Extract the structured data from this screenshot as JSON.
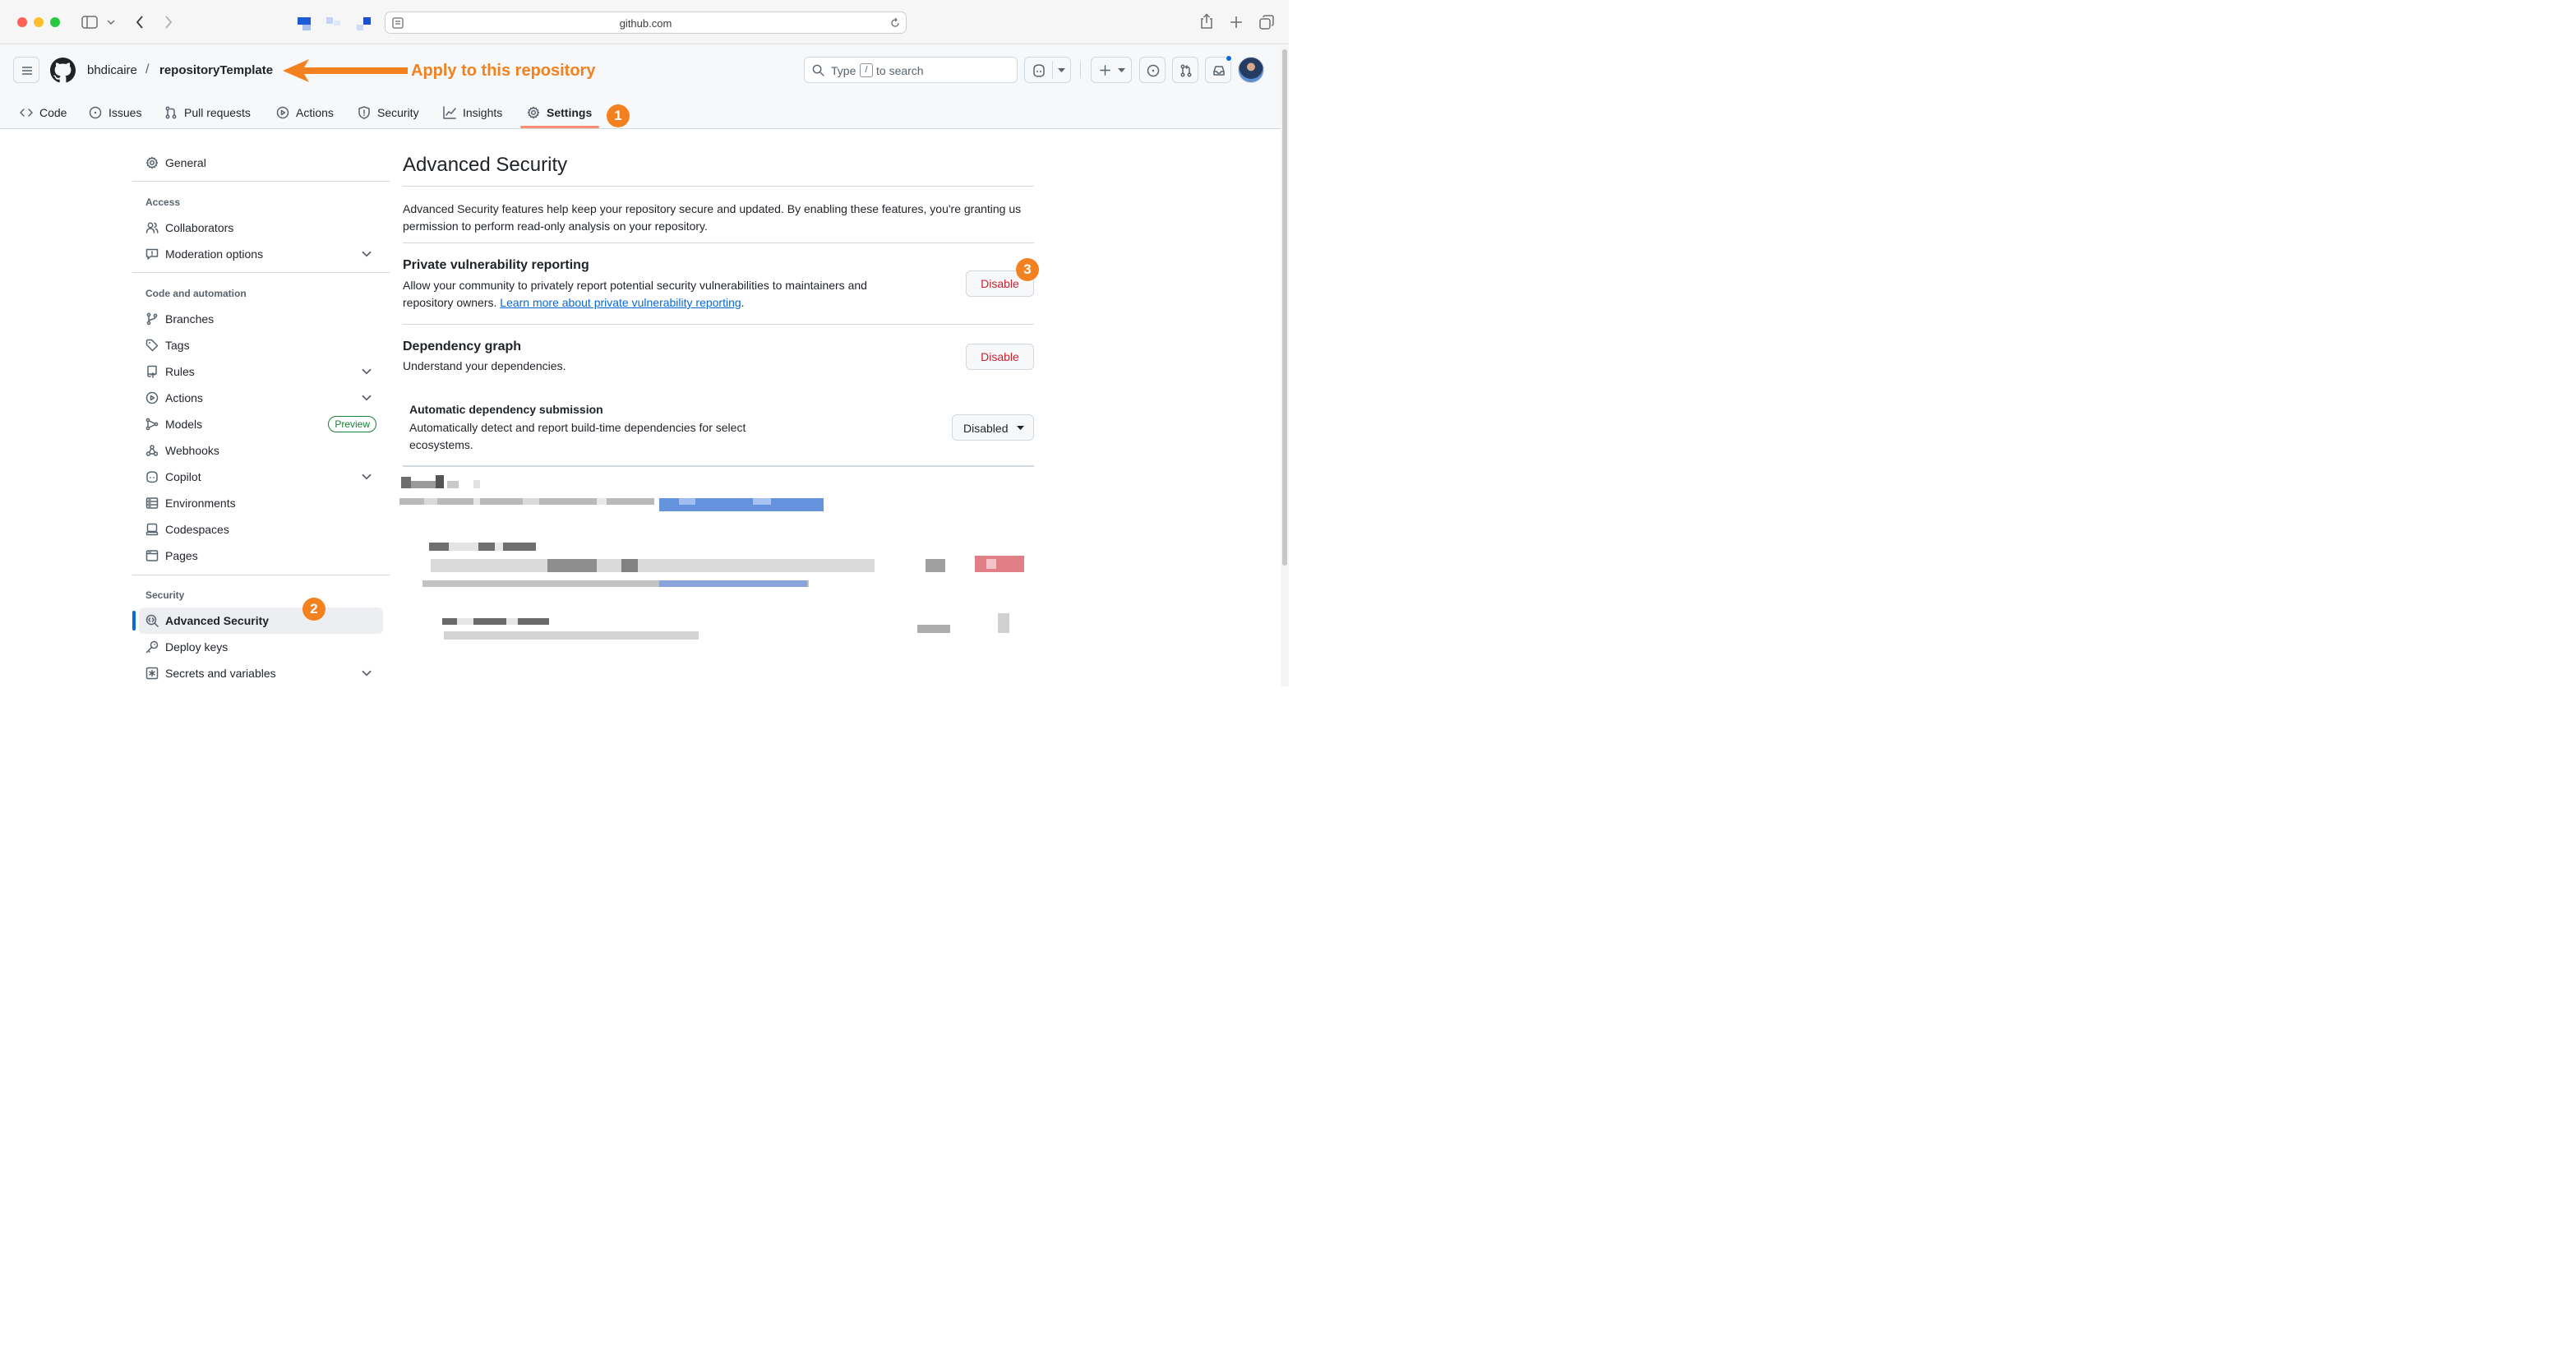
{
  "browser": {
    "url": "github.com"
  },
  "repo": {
    "owner": "bhdicaire",
    "separator": "/",
    "name": "repositoryTemplate"
  },
  "annotation": {
    "arrow_text": "Apply to this repository",
    "badge1": "1",
    "badge2": "2",
    "badge3": "3"
  },
  "search": {
    "pre": "Type",
    "key": "/",
    "post": "to search"
  },
  "tabs": [
    {
      "label": "Code",
      "icon": "code-icon"
    },
    {
      "label": "Issues",
      "icon": "issue-icon"
    },
    {
      "label": "Pull requests",
      "icon": "pull-request-icon"
    },
    {
      "label": "Actions",
      "icon": "play-icon"
    },
    {
      "label": "Security",
      "icon": "shield-icon"
    },
    {
      "label": "Insights",
      "icon": "graph-icon"
    },
    {
      "label": "Settings",
      "icon": "gear-icon",
      "selected": true
    }
  ],
  "sidebar": {
    "general": "General",
    "sections": [
      {
        "heading": "Access",
        "items": [
          {
            "label": "Collaborators",
            "icon": "people-icon"
          },
          {
            "label": "Moderation options",
            "icon": "report-icon",
            "expandable": true
          }
        ]
      },
      {
        "heading": "Code and automation",
        "items": [
          {
            "label": "Branches",
            "icon": "branch-icon"
          },
          {
            "label": "Tags",
            "icon": "tag-icon"
          },
          {
            "label": "Rules",
            "icon": "repo-push-icon",
            "expandable": true
          },
          {
            "label": "Actions",
            "icon": "play-icon",
            "expandable": true
          },
          {
            "label": "Models",
            "icon": "models-icon",
            "badge": "Preview"
          },
          {
            "label": "Webhooks",
            "icon": "webhook-icon"
          },
          {
            "label": "Copilot",
            "icon": "copilot-icon",
            "expandable": true
          },
          {
            "label": "Environments",
            "icon": "server-icon"
          },
          {
            "label": "Codespaces",
            "icon": "codespaces-icon"
          },
          {
            "label": "Pages",
            "icon": "browser-icon"
          }
        ]
      },
      {
        "heading": "Security",
        "items": [
          {
            "label": "Advanced Security",
            "icon": "codescan-icon",
            "selected": true
          },
          {
            "label": "Deploy keys",
            "icon": "key-icon"
          },
          {
            "label": "Secrets and variables",
            "icon": "key-asterisk-icon",
            "expandable": true
          }
        ]
      }
    ]
  },
  "main": {
    "title": "Advanced Security",
    "intro": "Advanced Security features help keep your repository secure and updated. By enabling these features, you're granting us permission to perform read-only analysis on your repository.",
    "pvr": {
      "title": "Private vulnerability reporting",
      "desc": "Allow your community to privately report potential security vulnerabilities to maintainers and repository owners.",
      "link": "Learn more about private vulnerability reporting",
      "tail": ".",
      "button": "Disable"
    },
    "depgraph": {
      "title": "Dependency graph",
      "desc": "Understand your dependencies.",
      "button": "Disable"
    },
    "autosub": {
      "title": "Automatic dependency submission",
      "desc": "Automatically detect and report build-time dependencies for select ecosystems.",
      "dropdown": "Disabled"
    }
  },
  "colors": {
    "accent": "#f48120",
    "danger": "#cf222e",
    "link": "#0969da",
    "selected": "#0969da"
  }
}
